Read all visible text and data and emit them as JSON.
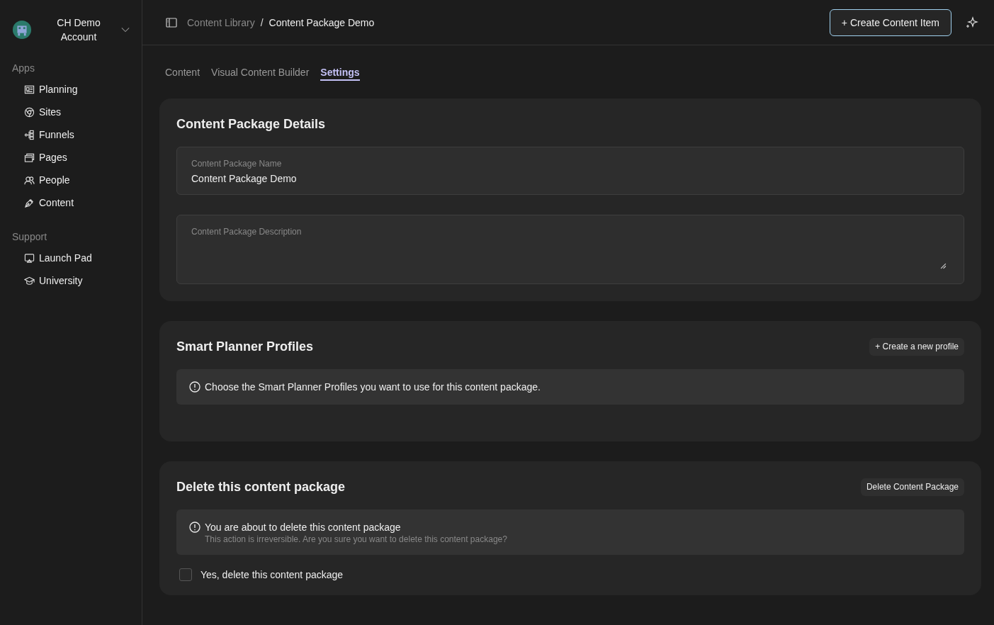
{
  "account": {
    "name": "CH Demo Account"
  },
  "sidebar": {
    "sections": [
      {
        "title": "Apps",
        "items": [
          {
            "label": "Planning"
          },
          {
            "label": "Sites"
          },
          {
            "label": "Funnels"
          },
          {
            "label": "Pages"
          },
          {
            "label": "People"
          },
          {
            "label": "Content"
          }
        ]
      },
      {
        "title": "Support",
        "items": [
          {
            "label": "Launch Pad"
          },
          {
            "label": "University"
          }
        ]
      }
    ]
  },
  "breadcrumb": [
    {
      "label": "Content Library",
      "current": false
    },
    {
      "label": "Content Package Demo",
      "current": true
    }
  ],
  "breadcrumb_separator": "/",
  "create_button": "+ Create Content Item",
  "tabs": [
    {
      "label": "Content",
      "selected": false
    },
    {
      "label": "Visual Content Builder",
      "selected": false
    },
    {
      "label": "Settings",
      "selected": true
    }
  ],
  "details": {
    "title": "Content Package Details",
    "name_field": {
      "label": "Content Package Name",
      "value": "Content Package Demo"
    },
    "description_field": {
      "label": "Content Package Description"
    }
  },
  "profiles": {
    "title": "Smart Planner Profiles",
    "button": "+ Create a new profile",
    "notice": "Choose the Smart Planner Profiles you want to use for this content package."
  },
  "delete": {
    "title": "Delete this content package",
    "button": "Delete Content Package",
    "notice_title": "You are about to delete this content package",
    "notice_text": "This action is irreversible. Are you sure you want to delete this content package?",
    "confirm": {
      "label": "Yes, delete this content package",
      "checked": false
    }
  }
}
